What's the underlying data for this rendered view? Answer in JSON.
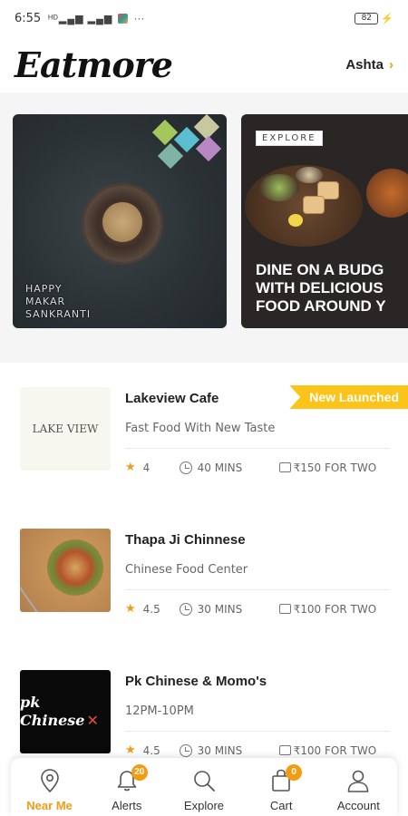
{
  "status_bar": {
    "time": "6:55",
    "signal_text": "ᴴᴰ▐▐▐ ▐▐▐",
    "more": "···",
    "battery": "82",
    "charging_icon": "bolt-icon"
  },
  "header": {
    "logo": "Eatmore",
    "account_name": "Ashta",
    "chevron": "›"
  },
  "banners": [
    {
      "festival_line1": "HAPPY",
      "festival_line2": "MAKAR",
      "festival_line3": "SANKRANTI"
    },
    {
      "tag": "EXPLORE",
      "headline_line1": "DINE ON A BUDG",
      "headline_line2": "WITH DELICIOUS",
      "headline_line3": "FOOD AROUND Y"
    }
  ],
  "restaurants": [
    {
      "name": "Lakeview Cafe",
      "subtitle": "Fast Food With New Taste",
      "rating": "4",
      "time": "40 MINS",
      "price": "₹150 FOR TWO",
      "badge": "New Launched",
      "logo_text": "LAKE VIEW"
    },
    {
      "name": "Thapa Ji Chinnese",
      "subtitle": "Chinese Food Center",
      "rating": "4.5",
      "time": "30 MINS",
      "price": "₹100 FOR TWO"
    },
    {
      "name": "Pk Chinese & Momo's",
      "subtitle": "12PM-10PM",
      "rating": "4.5",
      "time": "30 MINS",
      "price": "₹100 FOR TWO",
      "logo_text": "pk Chinese"
    }
  ],
  "bottom_nav": {
    "items": [
      {
        "label": "Near Me",
        "icon": "location-pin-icon",
        "active": true
      },
      {
        "label": "Alerts",
        "icon": "bell-icon",
        "badge": "20"
      },
      {
        "label": "Explore",
        "icon": "search-icon"
      },
      {
        "label": "Cart",
        "icon": "shopping-bag-icon",
        "badge": "0"
      },
      {
        "label": "Account",
        "icon": "user-icon"
      }
    ]
  },
  "colors": {
    "accent": "#f39c12",
    "badge_yellow": "#fcc419",
    "text_dark": "#222222",
    "text_muted": "#666666"
  }
}
